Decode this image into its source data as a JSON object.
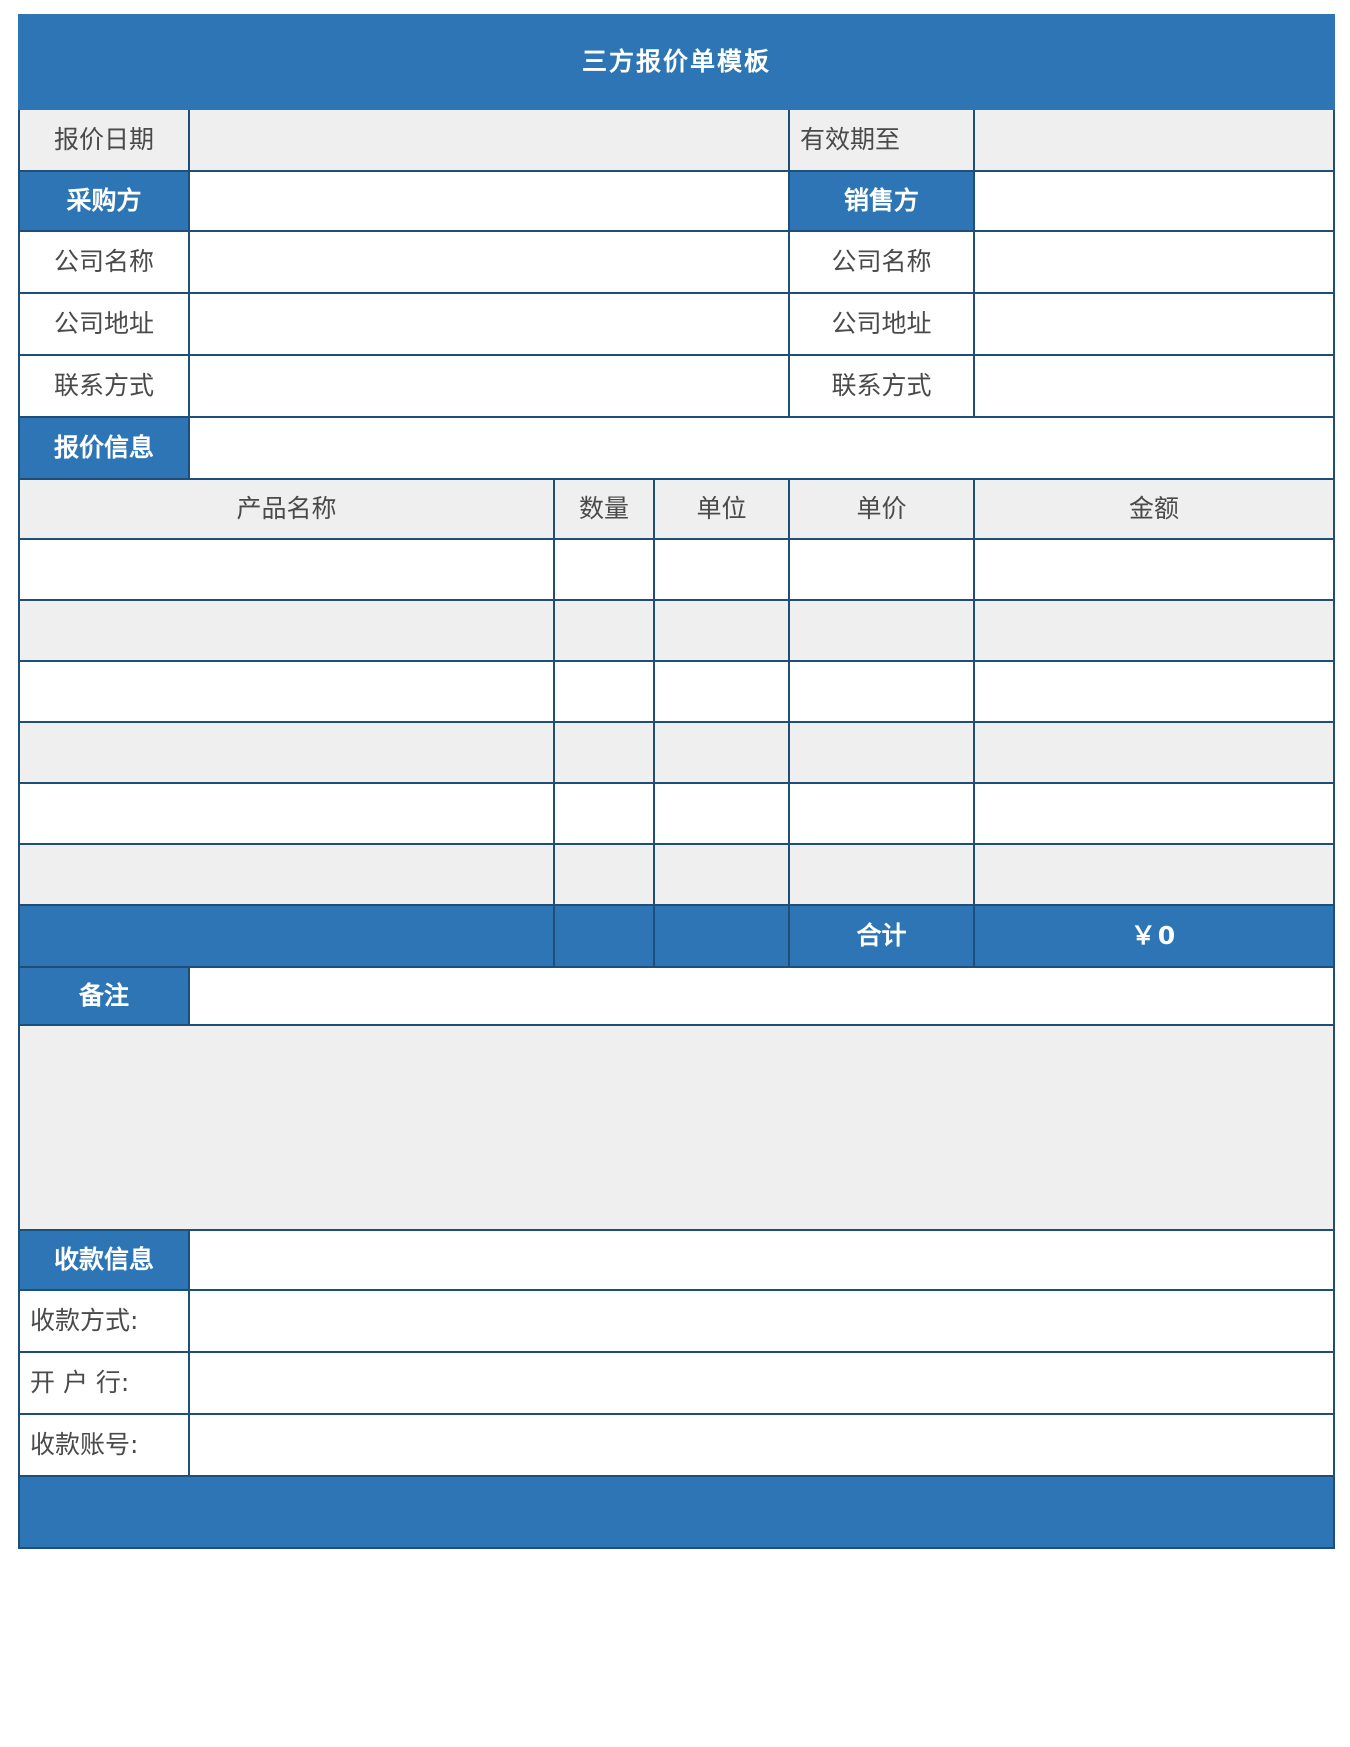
{
  "document": {
    "title": "三方报价单模板",
    "currency_symbol": "¥"
  },
  "meta_row": {
    "quote_date_label": "报价日期",
    "quote_date_value": "",
    "valid_until_label": "有效期至",
    "valid_until_value": ""
  },
  "buyer": {
    "section_label": "采购方",
    "section_value": "",
    "fields": [
      {
        "label": "公司名称",
        "value": ""
      },
      {
        "label": "公司地址",
        "value": ""
      },
      {
        "label": "联系方式",
        "value": ""
      }
    ]
  },
  "seller": {
    "section_label": "销售方",
    "section_value": "",
    "fields": [
      {
        "label": "公司名称",
        "value": ""
      },
      {
        "label": "公司地址",
        "value": ""
      },
      {
        "label": "联系方式",
        "value": ""
      }
    ]
  },
  "quote_info": {
    "section_label": "报价信息",
    "section_value": ""
  },
  "items_table": {
    "columns": [
      "产品名称",
      "数量",
      "单位",
      "单价",
      "金额"
    ],
    "rows": [
      {
        "product": "",
        "quantity": "",
        "unit": "",
        "unit_price": "",
        "amount": ""
      },
      {
        "product": "",
        "quantity": "",
        "unit": "",
        "unit_price": "",
        "amount": ""
      },
      {
        "product": "",
        "quantity": "",
        "unit": "",
        "unit_price": "",
        "amount": ""
      },
      {
        "product": "",
        "quantity": "",
        "unit": "",
        "unit_price": "",
        "amount": ""
      },
      {
        "product": "",
        "quantity": "",
        "unit": "",
        "unit_price": "",
        "amount": ""
      },
      {
        "product": "",
        "quantity": "",
        "unit": "",
        "unit_price": "",
        "amount": ""
      }
    ],
    "total_label": "合计",
    "total_value": "￥0"
  },
  "remarks": {
    "label": "备注",
    "header_value": "",
    "body_value": ""
  },
  "payment": {
    "section_label": "收款信息",
    "section_value": "",
    "fields": [
      {
        "label": "收款方式:",
        "value": "",
        "spaced": false
      },
      {
        "label": "开 户 行:",
        "value": "",
        "spaced": true
      },
      {
        "label": "收款账号:",
        "value": "",
        "spaced": false
      }
    ]
  },
  "colors": {
    "accent_blue": "#2e75b6",
    "border_blue": "#1f4e79",
    "band_gray": "#efefef",
    "text_gray": "#595959",
    "white": "#ffffff"
  }
}
